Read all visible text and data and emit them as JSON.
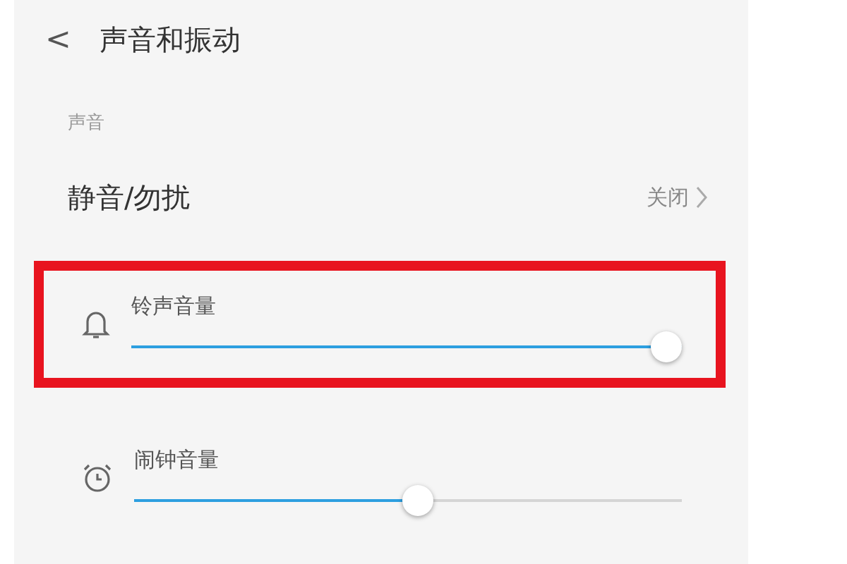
{
  "header": {
    "back": "<",
    "title": "声音和振动"
  },
  "section": "声音",
  "dnd_row": {
    "label": "静音/勿扰",
    "value": "关闭"
  },
  "sliders": [
    {
      "kind": "bell",
      "label": "铃声音量",
      "level": 1.0,
      "highlighted": true
    },
    {
      "kind": "alarm",
      "label": "闹钟音量",
      "level": 0.52,
      "highlighted": false
    }
  ]
}
